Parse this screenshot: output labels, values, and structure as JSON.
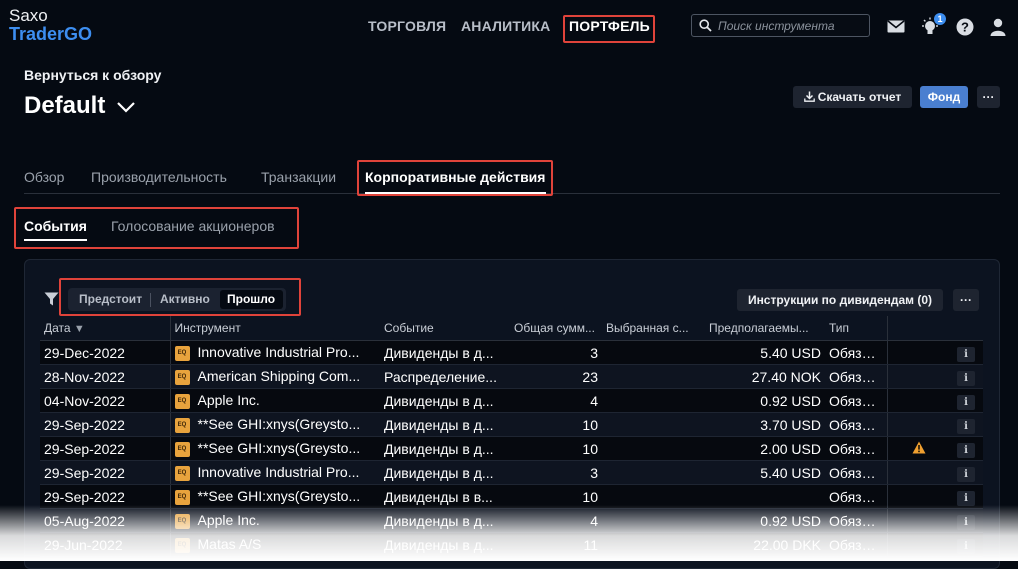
{
  "brand": {
    "line1": "Saxo",
    "line2": "TraderGO"
  },
  "nav": [
    {
      "label": "ТОРГОВЛЯ"
    },
    {
      "label": "АНАЛИТИКА"
    },
    {
      "label": "ПОРТФЕЛЬ",
      "active": true
    }
  ],
  "search": {
    "placeholder": "Поиск инструмента",
    "value": ""
  },
  "topbar_icons": {
    "notifications_badge": "1",
    "icons": [
      "mail-icon",
      "lightbulb-icon",
      "help-icon",
      "user-icon"
    ]
  },
  "page": {
    "back_link": "Вернуться к обзору",
    "title": "Default",
    "download_label": "Скачать отчет",
    "fund_label": "Фонд",
    "more_label": "···"
  },
  "tabs": [
    {
      "label": "Обзор"
    },
    {
      "label": "Производительность"
    },
    {
      "label": "Транзакции"
    },
    {
      "label": "Корпоративные действия",
      "active": true
    }
  ],
  "subtabs": [
    {
      "label": "События",
      "active": true
    },
    {
      "label": "Голосование акционеров"
    }
  ],
  "filters": {
    "segments": [
      "Предстоит",
      "Активно",
      "Прошло"
    ],
    "selected": "Прошло"
  },
  "dividend_button": "Инструкции по дивидендам (0)",
  "panel_more_label": "···",
  "table": {
    "columns": [
      "Дата",
      "Инструмент",
      "Событие",
      "Общая сумм...",
      "Выбранная с...",
      "Предполагаемы...",
      "Тип"
    ],
    "sort_indicator": "▼",
    "info_label": "i",
    "eq_label": "EQ",
    "rows": [
      {
        "date": "29-Dec-2022",
        "instrument": "Innovative Industrial Pro...",
        "event": "Дивиденды в д...",
        "total": "3",
        "selected": "",
        "estimated": "5.40 USD",
        "type": "Обязател",
        "warning": false
      },
      {
        "date": "28-Nov-2022",
        "instrument": "American Shipping Com...",
        "event": "Распределение...",
        "total": "23",
        "selected": "",
        "estimated": "27.40 NOK",
        "type": "Обязател",
        "warning": false
      },
      {
        "date": "04-Nov-2022",
        "instrument": "Apple Inc.",
        "event": "Дивиденды в д...",
        "total": "4",
        "selected": "",
        "estimated": "0.92 USD",
        "type": "Обязател",
        "warning": false
      },
      {
        "date": "29-Sep-2022",
        "instrument": "**See GHI:xnys(Greysto...",
        "event": "Дивиденды в д...",
        "total": "10",
        "selected": "",
        "estimated": "3.70 USD",
        "type": "Обязател",
        "warning": false
      },
      {
        "date": "29-Sep-2022",
        "instrument": "**See GHI:xnys(Greysto...",
        "event": "Дивиденды в д...",
        "total": "10",
        "selected": "",
        "estimated": "2.00 USD",
        "type": "Обязател",
        "warning": true
      },
      {
        "date": "29-Sep-2022",
        "instrument": "Innovative Industrial Pro...",
        "event": "Дивиденды в д...",
        "total": "3",
        "selected": "",
        "estimated": "5.40 USD",
        "type": "Обязател",
        "warning": false
      },
      {
        "date": "29-Sep-2022",
        "instrument": "**See GHI:xnys(Greysto...",
        "event": "Дивиденды в в...",
        "total": "10",
        "selected": "",
        "estimated": "",
        "type": "Обязател",
        "warning": false
      },
      {
        "date": "05-Aug-2022",
        "instrument": "Apple Inc.",
        "event": "Дивиденды в д...",
        "total": "4",
        "selected": "",
        "estimated": "0.92 USD",
        "type": "Обязател",
        "warning": false
      },
      {
        "date": "29-Jun-2022",
        "instrument": "Matas A/S",
        "event": "Дивиденды в д...",
        "total": "11",
        "selected": "",
        "estimated": "22.00 DKK",
        "type": "Обязател",
        "warning": false
      }
    ]
  },
  "colors": {
    "accent_blue": "#3d8ef0",
    "highlight_red": "#e0433a",
    "eq_orange": "#e8a33d",
    "warning_orange": "#f0a030"
  }
}
